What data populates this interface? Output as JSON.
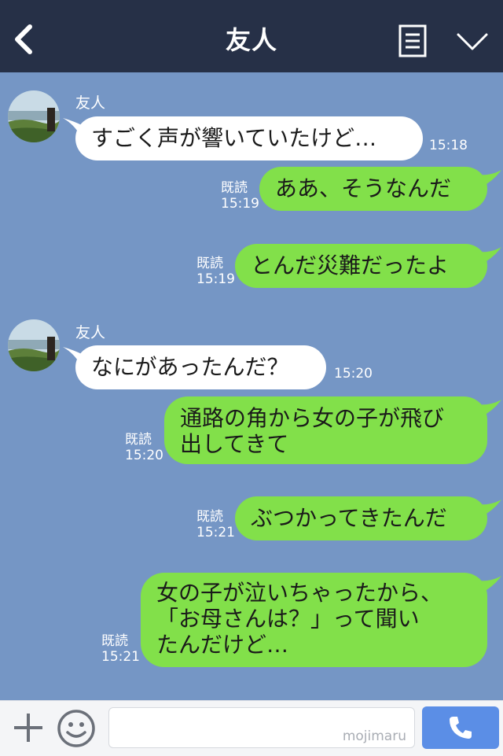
{
  "header": {
    "title": "友人"
  },
  "messages": [
    {
      "side": "in",
      "sender": "友人",
      "text": "すごく声が響いていたけど…",
      "time": "15:18"
    },
    {
      "side": "out",
      "read": "既読",
      "time": "15:19",
      "text": "ああ、そうなんだ"
    },
    {
      "side": "out",
      "read": "既読",
      "time": "15:19",
      "text": "とんだ災難だったよ"
    },
    {
      "side": "in",
      "sender": "友人",
      "text": "なにがあったんだ？",
      "time": "15:20"
    },
    {
      "side": "out",
      "read": "既読",
      "time": "15:20",
      "lines": [
        "通路の角から女の子が飛び",
        "出してきて"
      ]
    },
    {
      "side": "out",
      "read": "既読",
      "time": "15:21",
      "text": "ぶつかってきたんだ"
    },
    {
      "side": "out",
      "read": "既読",
      "time": "15:21",
      "lines": [
        "女の子が泣いちゃったから、",
        "「お母さんは？」って聞い",
        "たんだけど…"
      ]
    }
  ],
  "footer": {
    "input_value": "",
    "watermark": "mojimaru"
  },
  "colors": {
    "header_bg": "#263047",
    "chat_bg": "#7596c5",
    "bubble_in": "#ffffff",
    "bubble_out": "#82e04a",
    "call_button": "#5b8ee6"
  },
  "icons": {
    "back": "chevron-left-icon",
    "menu": "note-list-icon",
    "collapse": "chevron-down-icon",
    "add": "plus-icon",
    "emoji": "smile-icon",
    "call": "phone-icon"
  }
}
